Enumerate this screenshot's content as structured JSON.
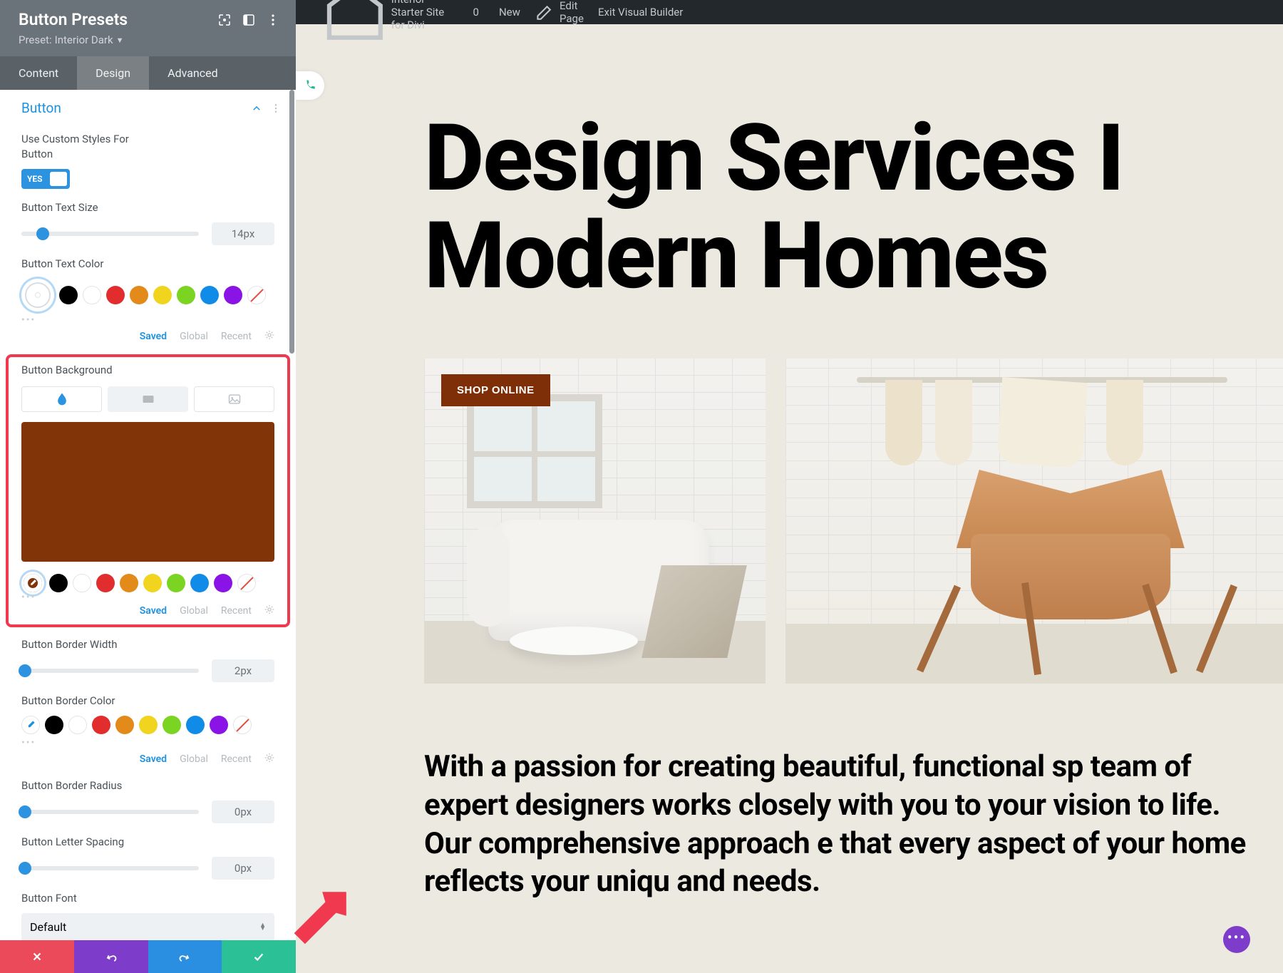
{
  "adminBar": {
    "siteName": "Interior Starter Site for Divi",
    "comments": "0",
    "newLabel": "New",
    "editPage": "Edit Page",
    "exitVB": "Exit Visual Builder"
  },
  "sidebar": {
    "title": "Button Presets",
    "presetPrefix": "Preset:",
    "presetName": "Interior Dark",
    "tabs": {
      "content": "Content",
      "design": "Design",
      "advanced": "Advanced"
    },
    "section": "Button",
    "useCustom": {
      "label": "Use Custom Styles For Button",
      "toggle": "YES"
    },
    "textSize": {
      "label": "Button Text Size",
      "value": "14px",
      "pos": 12
    },
    "textColor": {
      "label": "Button Text Color",
      "footer": {
        "saved": "Saved",
        "global": "Global",
        "recent": "Recent"
      }
    },
    "bg": {
      "label": "Button Background",
      "color": "#823409",
      "footer": {
        "saved": "Saved",
        "global": "Global",
        "recent": "Recent"
      }
    },
    "borderWidth": {
      "label": "Button Border Width",
      "value": "2px",
      "pos": 2
    },
    "borderColor": {
      "label": "Button Border Color",
      "footer": {
        "saved": "Saved",
        "global": "Global",
        "recent": "Recent"
      }
    },
    "borderRadius": {
      "label": "Button Border Radius",
      "value": "0px",
      "pos": 2
    },
    "letterSpacing": {
      "label": "Button Letter Spacing",
      "value": "0px",
      "pos": 2
    },
    "font": {
      "label": "Button Font",
      "value": "Default"
    }
  },
  "preview": {
    "heading1": "Design Services I",
    "heading2": "Modern Homes",
    "shop": "SHOP ONLINE",
    "copy": "With a passion for creating beautiful, functional sp team of expert designers works closely with you to your vision to life. Our comprehensive approach e that every aspect of your home reflects your uniqu and needs."
  },
  "palette": [
    "#000000",
    "#ffffff",
    "#e12d2d",
    "#e28a1a",
    "#f0d41e",
    "#7bd421",
    "#108ce8",
    "#8a13e5"
  ]
}
